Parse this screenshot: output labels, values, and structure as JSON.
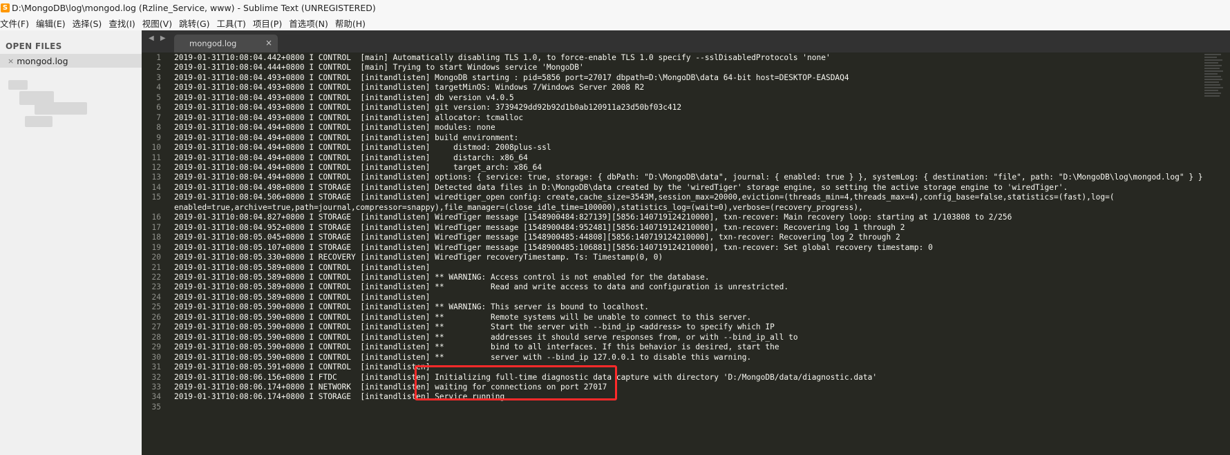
{
  "window": {
    "title": "D:\\MongoDB\\log\\mongod.log (Rzline_Service, www) - Sublime Text (UNREGISTERED)"
  },
  "menubar": [
    "文件(F)",
    "编辑(E)",
    "选择(S)",
    "查找(I)",
    "视图(V)",
    "跳转(G)",
    "工具(T)",
    "项目(P)",
    "首选项(N)",
    "帮助(H)"
  ],
  "sidebar": {
    "header": "OPEN FILES",
    "files": [
      {
        "name": "mongod.log",
        "close_glyph": "×"
      }
    ]
  },
  "tabs": [
    {
      "label": "mongod.log",
      "close_glyph": "×"
    }
  ],
  "nav_arrows": "◀ ▶",
  "lines": [
    {
      "n": "1",
      "text": "2019-01-31T10:08:04.442+0800 I CONTROL  [main] Automatically disabling TLS 1.0, to force-enable TLS 1.0 specify --sslDisabledProtocols 'none'"
    },
    {
      "n": "2",
      "text": "2019-01-31T10:08:04.444+0800 I CONTROL  [main] Trying to start Windows service 'MongoDB'"
    },
    {
      "n": "3",
      "text": "2019-01-31T10:08:04.493+0800 I CONTROL  [initandlisten] MongoDB starting : pid=5856 port=27017 dbpath=D:\\MongoDB\\data 64-bit host=DESKTOP-EASDAQ4"
    },
    {
      "n": "4",
      "text": "2019-01-31T10:08:04.493+0800 I CONTROL  [initandlisten] targetMinOS: Windows 7/Windows Server 2008 R2"
    },
    {
      "n": "5",
      "text": "2019-01-31T10:08:04.493+0800 I CONTROL  [initandlisten] db version v4.0.5"
    },
    {
      "n": "6",
      "text": "2019-01-31T10:08:04.493+0800 I CONTROL  [initandlisten] git version: 3739429dd92b92d1b0ab120911a23d50bf03c412"
    },
    {
      "n": "7",
      "text": "2019-01-31T10:08:04.493+0800 I CONTROL  [initandlisten] allocator: tcmalloc"
    },
    {
      "n": "8",
      "text": "2019-01-31T10:08:04.494+0800 I CONTROL  [initandlisten] modules: none"
    },
    {
      "n": "9",
      "text": "2019-01-31T10:08:04.494+0800 I CONTROL  [initandlisten] build environment:"
    },
    {
      "n": "10",
      "text": "2019-01-31T10:08:04.494+0800 I CONTROL  [initandlisten]     distmod: 2008plus-ssl"
    },
    {
      "n": "11",
      "text": "2019-01-31T10:08:04.494+0800 I CONTROL  [initandlisten]     distarch: x86_64"
    },
    {
      "n": "12",
      "text": "2019-01-31T10:08:04.494+0800 I CONTROL  [initandlisten]     target_arch: x86_64"
    },
    {
      "n": "13",
      "text": "2019-01-31T10:08:04.494+0800 I CONTROL  [initandlisten] options: { service: true, storage: { dbPath: \"D:\\MongoDB\\data\", journal: { enabled: true } }, systemLog: { destination: \"file\", path: \"D:\\MongoDB\\log\\mongod.log\" } }"
    },
    {
      "n": "14",
      "text": "2019-01-31T10:08:04.498+0800 I STORAGE  [initandlisten] Detected data files in D:\\MongoDB\\data created by the 'wiredTiger' storage engine, so setting the active storage engine to 'wiredTiger'."
    },
    {
      "n": "15",
      "text": "2019-01-31T10:08:04.506+0800 I STORAGE  [initandlisten] wiredtiger_open config: create,cache_size=3543M,session_max=20000,eviction=(threads_min=4,threads_max=4),config_base=false,statistics=(fast),log=("
    },
    {
      "n": "",
      "text": "enabled=true,archive=true,path=journal,compressor=snappy),file_manager=(close_idle_time=100000),statistics_log=(wait=0),verbose=(recovery_progress),"
    },
    {
      "n": "16",
      "text": "2019-01-31T10:08:04.827+0800 I STORAGE  [initandlisten] WiredTiger message [1548900484:827139][5856:140719124210000], txn-recover: Main recovery loop: starting at 1/103808 to 2/256"
    },
    {
      "n": "17",
      "text": "2019-01-31T10:08:04.952+0800 I STORAGE  [initandlisten] WiredTiger message [1548900484:952481][5856:140719124210000], txn-recover: Recovering log 1 through 2"
    },
    {
      "n": "18",
      "text": "2019-01-31T10:08:05.045+0800 I STORAGE  [initandlisten] WiredTiger message [1548900485:44808][5856:140719124210000], txn-recover: Recovering log 2 through 2"
    },
    {
      "n": "19",
      "text": "2019-01-31T10:08:05.107+0800 I STORAGE  [initandlisten] WiredTiger message [1548900485:106881][5856:140719124210000], txn-recover: Set global recovery timestamp: 0"
    },
    {
      "n": "20",
      "text": "2019-01-31T10:08:05.330+0800 I RECOVERY [initandlisten] WiredTiger recoveryTimestamp. Ts: Timestamp(0, 0)"
    },
    {
      "n": "21",
      "text": "2019-01-31T10:08:05.589+0800 I CONTROL  [initandlisten]"
    },
    {
      "n": "22",
      "text": "2019-01-31T10:08:05.589+0800 I CONTROL  [initandlisten] ** WARNING: Access control is not enabled for the database."
    },
    {
      "n": "23",
      "text": "2019-01-31T10:08:05.589+0800 I CONTROL  [initandlisten] **          Read and write access to data and configuration is unrestricted."
    },
    {
      "n": "24",
      "text": "2019-01-31T10:08:05.589+0800 I CONTROL  [initandlisten]"
    },
    {
      "n": "25",
      "text": "2019-01-31T10:08:05.590+0800 I CONTROL  [initandlisten] ** WARNING: This server is bound to localhost."
    },
    {
      "n": "26",
      "text": "2019-01-31T10:08:05.590+0800 I CONTROL  [initandlisten] **          Remote systems will be unable to connect to this server."
    },
    {
      "n": "27",
      "text": "2019-01-31T10:08:05.590+0800 I CONTROL  [initandlisten] **          Start the server with --bind_ip <address> to specify which IP"
    },
    {
      "n": "28",
      "text": "2019-01-31T10:08:05.590+0800 I CONTROL  [initandlisten] **          addresses it should serve responses from, or with --bind_ip_all to"
    },
    {
      "n": "29",
      "text": "2019-01-31T10:08:05.590+0800 I CONTROL  [initandlisten] **          bind to all interfaces. If this behavior is desired, start the"
    },
    {
      "n": "30",
      "text": "2019-01-31T10:08:05.590+0800 I CONTROL  [initandlisten] **          server with --bind_ip 127.0.0.1 to disable this warning."
    },
    {
      "n": "31",
      "text": "2019-01-31T10:08:05.591+0800 I CONTROL  [initandlisten]"
    },
    {
      "n": "32",
      "text": "2019-01-31T10:08:06.156+0800 I FTDC     [initandlisten] Initializing full-time diagnostic data capture with directory 'D:/MongoDB/data/diagnostic.data'"
    },
    {
      "n": "33",
      "text": "2019-01-31T10:08:06.174+0800 I NETWORK  [initandlisten] waiting for connections on port 27017"
    },
    {
      "n": "34",
      "text": "2019-01-31T10:08:06.174+0800 I STORAGE  [initandlisten] Service running"
    },
    {
      "n": "35",
      "text": ""
    }
  ]
}
